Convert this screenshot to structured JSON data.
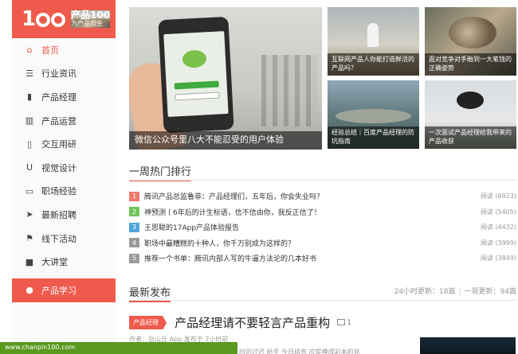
{
  "logo": {
    "number": "1",
    "brand": "产品100",
    "slogan": "为产品而生"
  },
  "nav": [
    {
      "label": "首页",
      "icon": "home-icon",
      "glyph": "⌂",
      "state": "active"
    },
    {
      "label": "行业资讯",
      "icon": "list-icon",
      "glyph": "☰",
      "state": ""
    },
    {
      "label": "产品经理",
      "icon": "briefcase-icon",
      "glyph": "▮",
      "state": ""
    },
    {
      "label": "产品运营",
      "icon": "bar-chart-icon",
      "glyph": "▥",
      "state": ""
    },
    {
      "label": "交互用研",
      "icon": "book-icon",
      "glyph": "▯",
      "state": ""
    },
    {
      "label": "视觉设计",
      "icon": "magnet-icon",
      "glyph": "U",
      "state": ""
    },
    {
      "label": "职场经验",
      "icon": "suitcase-icon",
      "glyph": "▭",
      "state": ""
    },
    {
      "label": "最新招聘",
      "icon": "send-icon",
      "glyph": "➤",
      "state": ""
    },
    {
      "label": "线下活动",
      "icon": "flag-icon",
      "glyph": "⚑",
      "state": ""
    },
    {
      "label": "大讲堂",
      "icon": "video-icon",
      "glyph": "■",
      "state": ""
    },
    {
      "label": "产品学习",
      "icon": "user-icon",
      "glyph": "●",
      "state": "selected"
    }
  ],
  "featured": {
    "main": "微信公众号里八大不能忍受的用户体验",
    "t1": "互联网产品人你能打造鲜活的产品吗？",
    "t2": "面对竞争对手融到一大笔钱的正确姿势",
    "t3": "经验总结｜百度产品经理的防坑指南",
    "t4": "一次面试产品经理给我带来的产品收获"
  },
  "hot": {
    "title": "一周热门排行",
    "items": [
      {
        "num": "1",
        "color": "#ef7a6e",
        "title": "腾讯产品总监鲁菲：产品经理们，五年后，你会失业吗？",
        "reads": "阅读 (6923)"
      },
      {
        "num": "2",
        "color": "#6fc45a",
        "title": "神预测丨6年后的计生标语，信不信由你，我反正信了！",
        "reads": "阅读 (5405)"
      },
      {
        "num": "3",
        "color": "#4ea6d8",
        "title": "王思聪的17App产品体验报告",
        "reads": "阅读 (4432)"
      },
      {
        "num": "4",
        "color": "#9a9a9a",
        "title": "职场中最糟糕的十种人，你千万别成为这样的？",
        "reads": "阅读 (3999)"
      },
      {
        "num": "5",
        "color": "#9a9a9a",
        "title": "推荐一个书单：腾讯内部人写的牛逼方法论的几本好书",
        "reads": "阅读 (3849)"
      }
    ]
  },
  "latest": {
    "title": "最新发布",
    "stat_24h": "24小时更新：18篇",
    "stat_week": "一周更新：94篇",
    "article": {
      "tag": "产品经理",
      "title": "产品经理请不要轻言产品重构",
      "img_count": "1",
      "meta": "作者：岳山丘   App 发布于 7小时前",
      "excerpt": "时的过迟 给手 今日组布 应提模成彩本的充"
    }
  },
  "status_url": "www.chanpin100.com"
}
